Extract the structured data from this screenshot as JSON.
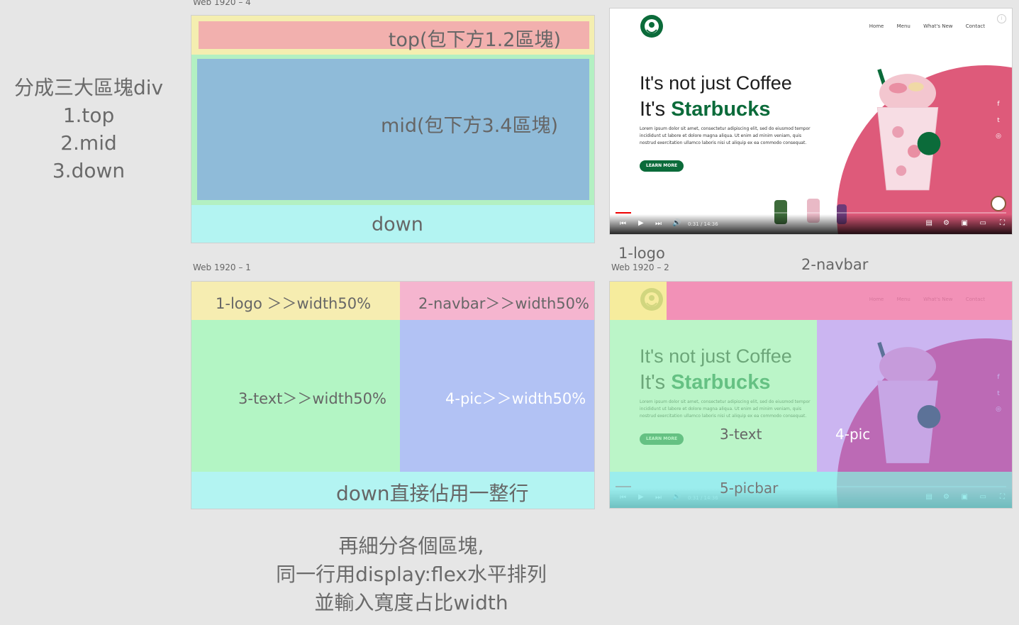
{
  "left_notes": [
    "分成三大區塊div",
    "1.top",
    "2.mid",
    "3.down"
  ],
  "wireframe_top": {
    "caption": "Web 1920 – 4",
    "top_label": "top(包下方1.2區塊)",
    "mid_label": "mid(包下方3.4區塊)",
    "down_label": "down",
    "colors": {
      "outer": "#f4eeb0",
      "top": "#f2b0ae",
      "mid_bg": "#b3f0c2",
      "mid": "#8fbbd9",
      "down": "#b3f4f2"
    }
  },
  "wireframe_bottom": {
    "caption": "Web 1920 – 1",
    "logo_label": "1-logo ＞＞width50%",
    "navbar_label": "2-navbar＞＞width50%",
    "text_label": "3-text＞＞width50%",
    "pic_label": "4-pic＞＞width50%",
    "down_label": "down直接佔用一整行",
    "colors": {
      "logo": "#f6edb1",
      "navbar": "#f5b5cf",
      "text": "#b3f5c4",
      "pic": "#b2c2f4",
      "down": "#b3f4f2"
    }
  },
  "bottom_notes": [
    "再細分各個區塊,",
    "同一行用display:flex水平排列",
    "並輸入寬度占比width"
  ],
  "mockup": {
    "nav": [
      "Home",
      "Menu",
      "What's New",
      "Contact"
    ],
    "headline1": "It's not just Coffee",
    "headline2_prefix": "It's ",
    "headline2_brand": "Starbucks",
    "lorem": "Lorem ipsum dolor sit amet, consectetur adipiscing elit, sed do eiusmod tempor incididunt ut labore et dolore magna aliqua. Ut enim ad minim veniam, quis nostrud exercitation ullamco laboris nisi ut aliquip ex ea commodo consequat.",
    "button": "LEARN MORE",
    "time": "0:31 / 14:36",
    "social_icons": [
      "f",
      "t",
      "◎"
    ],
    "colors": {
      "brand_green": "#0b6b3a",
      "pink": "#de5a7a",
      "progress_red": "#e00000"
    }
  },
  "annotated": {
    "caption": "Web 1920 – 2",
    "logo_label": "1-logo",
    "navbar_label": "2-navbar",
    "text_label": "3-text",
    "pic_label": "4-pic",
    "picbar_label": "5-picbar"
  }
}
